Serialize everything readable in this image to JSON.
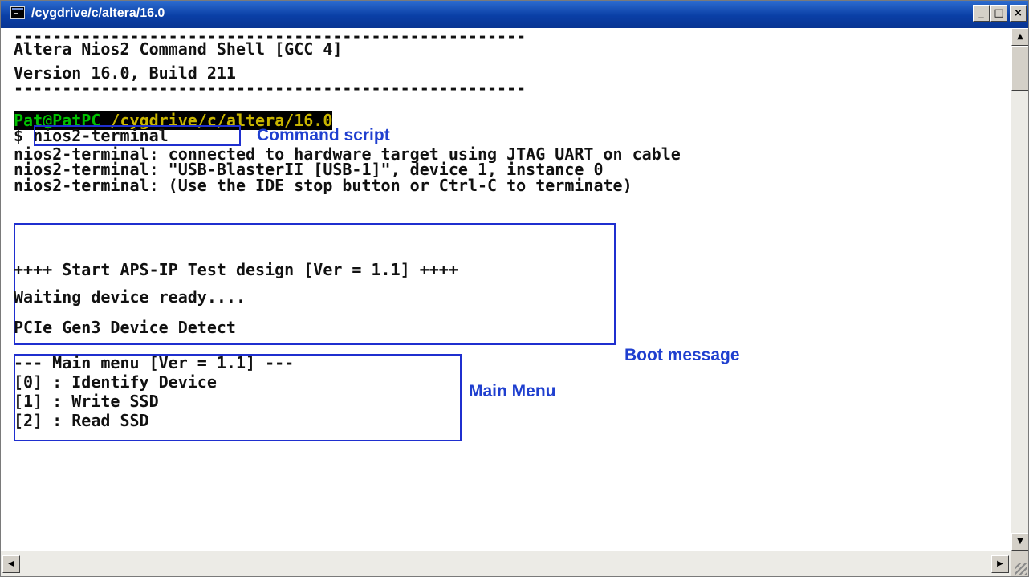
{
  "window": {
    "title": "/cygdrive/c/altera/16.0",
    "minimize_label": "_",
    "maximize_label": "□",
    "close_label": "×",
    "app_icon": "terminal-icon"
  },
  "console": {
    "separator": "-----------------------------------------------------",
    "banner_title": "Altera Nios2 Command Shell [GCC 4]",
    "banner_version": "Version 16.0, Build 211",
    "prompt_user": "Pat@PatPC",
    "prompt_path": " /cygdrive/c/altera/16.0",
    "prompt_symbol": "$ ",
    "command": "nios2-terminal",
    "output": [
      "nios2-terminal: connected to hardware target using JTAG UART on cable",
      "nios2-terminal: \"USB-BlasterII [USB-1]\", device 1, instance 0",
      "nios2-terminal: (Use the IDE stop button or Ctrl-C to terminate)"
    ],
    "boot": [
      "++++ Start APS-IP Test design [Ver = 1.1] ++++",
      "Waiting device ready....",
      "PCIe Gen3 Device Detect"
    ],
    "menu": [
      "--- Main menu [Ver = 1.1] ---",
      "[0] : Identify Device",
      "[1] : Write SSD",
      "[2] : Read SSD"
    ]
  },
  "annotations": {
    "command_script": "Command script",
    "boot_message": "Boot message",
    "main_menu": "Main Menu",
    "color": "#1f3fcf"
  },
  "scrollbar": {
    "up_icon": "arrow-up-icon",
    "down_icon": "arrow-down-icon",
    "left_icon": "arrow-left-icon",
    "right_icon": "arrow-right-icon"
  }
}
